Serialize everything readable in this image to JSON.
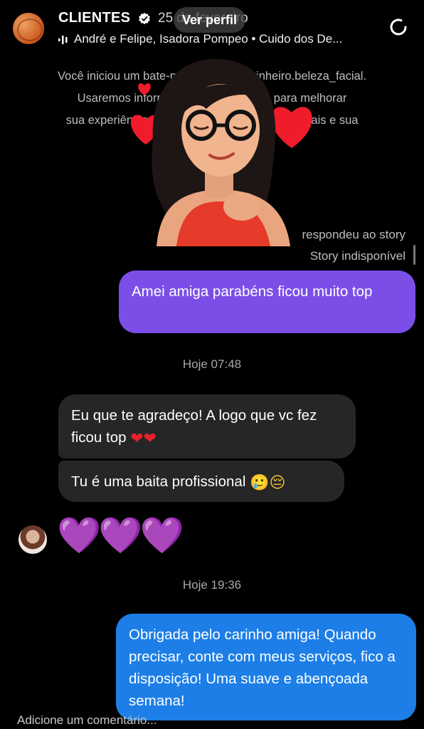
{
  "header": {
    "title": "CLIENTES",
    "date": "25 de fevereiro",
    "view_profile": "Ver perfil",
    "subtitle": "André e Felipe, Isadora Pompeo • Cuido dos De..."
  },
  "notice": {
    "line1": "Você iniciou um bate-papo com @ a.pinheiro.beleza_facial.",
    "line2": "Usaremos informações do bate-papo para melhorar",
    "line3": "sua experiência. Saiba mais sobre fins comerciais e sua"
  },
  "story": {
    "replied": "respondeu ao story",
    "unavailable": "Story indisponível"
  },
  "messages": [
    {
      "text": "Amei amiga parabéns ficou muito top"
    },
    {
      "time": "Hoje 07:48"
    },
    {
      "text": "Eu que te agradeço! A logo que vc fez ficou top",
      "emoji": "❤❤"
    },
    {
      "text": "Tu é uma baita profissional",
      "emoji": "🥲😔"
    },
    {
      "emoji": "💜💜💜"
    },
    {
      "time": "Hoje 19:36"
    },
    {
      "text": "Obrigada pelo carinho amiga! Quando precisar, conte com meus serviços, fico a disposição! Uma suave e abençoada semana!"
    }
  ],
  "footer": {
    "placeholder": "Adicione um comentário..."
  },
  "colors": {
    "sent_purple": "#7c4ee8",
    "sent_blue": "#1c7ee6",
    "received_gray": "#262626"
  }
}
